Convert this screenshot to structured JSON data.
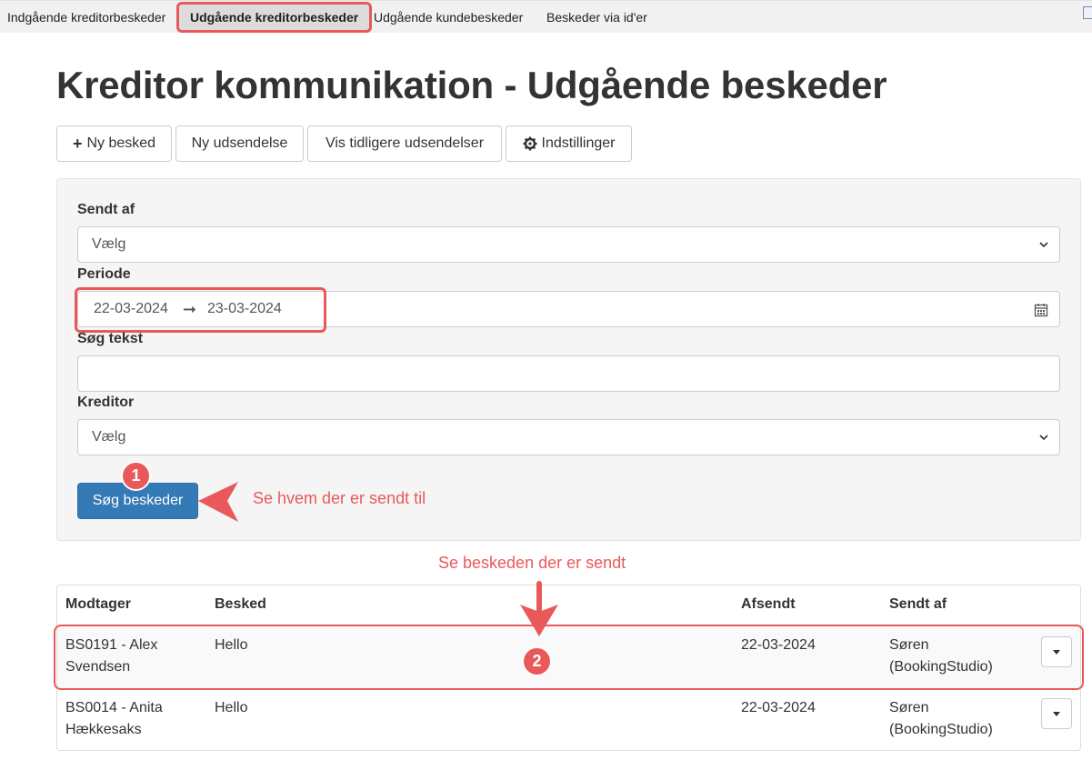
{
  "tabs": [
    {
      "label": "Indgående kreditorbeskeder"
    },
    {
      "label": "Udgående kreditorbeskeder"
    },
    {
      "label": "Udgående kundebeskeder"
    },
    {
      "label": "Beskeder via id'er"
    }
  ],
  "page": {
    "title": "Kreditor kommunikation - Udgående beskeder"
  },
  "toolbar": {
    "new_message": "Ny besked",
    "new_dispatch": "Ny udsendelse",
    "show_previous": "Vis tidligere udsendelser",
    "settings": "Indstillinger"
  },
  "filters": {
    "sent_by": {
      "label": "Sendt af",
      "value": "Vælg"
    },
    "period": {
      "label": "Periode",
      "from": "22-03-2024",
      "to": "23-03-2024"
    },
    "search_text": {
      "label": "Søg tekst",
      "value": ""
    },
    "creditor": {
      "label": "Kreditor",
      "value": "Vælg"
    },
    "search_button": "Søg beskeder"
  },
  "annotations": {
    "badge1": "1",
    "badge2": "2",
    "note1": "Se hvem der er sendt til",
    "note2": "Se beskeden der er sendt"
  },
  "table": {
    "headers": {
      "recipient": "Modtager",
      "message": "Besked",
      "sent": "Afsendt",
      "sent_by": "Sendt af"
    },
    "rows": [
      {
        "recipient_line1": "BS0191 - Alex",
        "recipient_line2": "Svendsen",
        "message": "Hello",
        "sent": "22-03-2024",
        "sent_by_line1": "Søren",
        "sent_by_line2": "(BookingStudio)"
      },
      {
        "recipient_line1": "BS0014 - Anita",
        "recipient_line2": "Hækkesaks",
        "message": "Hello",
        "sent": "22-03-2024",
        "sent_by_line1": "Søren",
        "sent_by_line2": "(BookingStudio)"
      }
    ]
  },
  "colors": {
    "accent": "#e9595a",
    "primary": "#337ab7"
  }
}
